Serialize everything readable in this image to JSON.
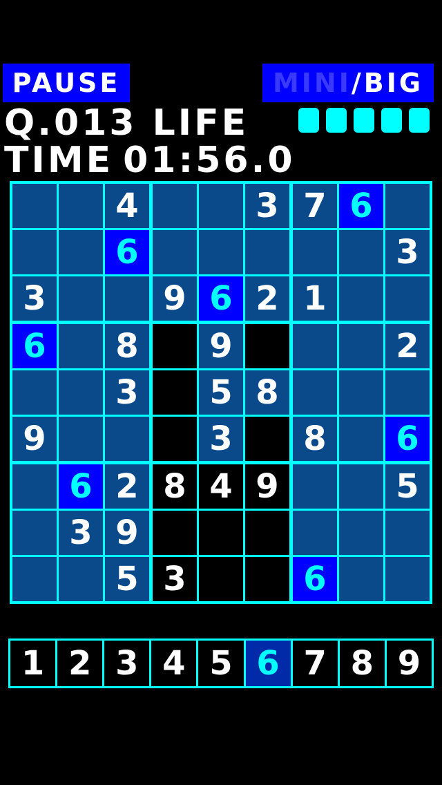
{
  "header": {
    "pause_label": "PAUSE",
    "mini_label": "MINI",
    "slash": "/",
    "big_label": "BIG"
  },
  "status": {
    "question": "Q.013",
    "life_label": "LIFE",
    "lives": 5,
    "time_label": "TIME",
    "time_value": "01:56.0"
  },
  "board": {
    "values": [
      [
        "",
        "",
        "4",
        "",
        "",
        "3",
        "7",
        "6",
        ""
      ],
      [
        "",
        "",
        "6",
        "",
        "",
        "",
        "",
        "",
        "3"
      ],
      [
        "3",
        "",
        "",
        "9",
        "6",
        "2",
        "1",
        "",
        ""
      ],
      [
        "6",
        "",
        "8",
        "",
        "9",
        "",
        "",
        "",
        "2"
      ],
      [
        "",
        "",
        "3",
        "",
        "5",
        "8",
        "",
        "",
        ""
      ],
      [
        "9",
        "",
        "",
        "",
        "3",
        "",
        "8",
        "",
        "6"
      ],
      [
        "",
        "6",
        "2",
        "8",
        "4",
        "9",
        "",
        "",
        "5"
      ],
      [
        "",
        "3",
        "9",
        "",
        "",
        "",
        "",
        "",
        ""
      ],
      [
        "",
        "",
        "5",
        "3",
        "",
        "",
        "6",
        "",
        ""
      ]
    ],
    "highlighted": [
      [
        0,
        7
      ],
      [
        1,
        2
      ],
      [
        2,
        4
      ],
      [
        3,
        0
      ],
      [
        5,
        8
      ],
      [
        6,
        1
      ],
      [
        8,
        6
      ]
    ],
    "dark_cells": [
      [
        3,
        3
      ],
      [
        3,
        5
      ],
      [
        4,
        3
      ],
      [
        5,
        3
      ],
      [
        5,
        5
      ],
      [
        6,
        3
      ],
      [
        6,
        4
      ],
      [
        6,
        5
      ],
      [
        7,
        3
      ],
      [
        7,
        4
      ],
      [
        7,
        5
      ],
      [
        8,
        3
      ],
      [
        8,
        4
      ],
      [
        8,
        5
      ]
    ],
    "colors": {
      "normal": "#0a4a8a",
      "dark": "#000000",
      "highlight": "#0000ff",
      "highlight_text": "#00ffff",
      "grid": "#00ffff"
    }
  },
  "numpad": {
    "keys": [
      "1",
      "2",
      "3",
      "4",
      "5",
      "6",
      "7",
      "8",
      "9"
    ],
    "selected": "6"
  }
}
